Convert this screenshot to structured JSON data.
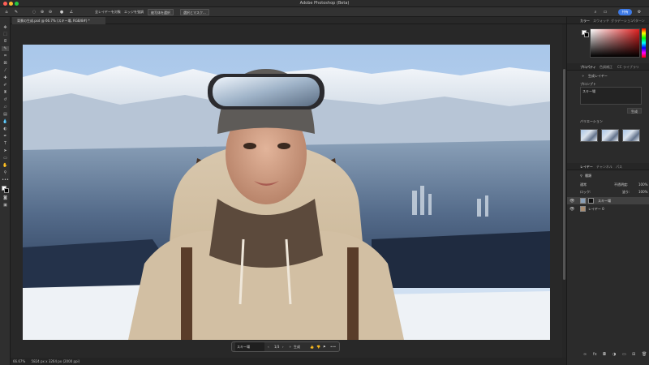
{
  "window": {
    "title": "Adobe Photoshop (Beta)"
  },
  "options_bar": {
    "sample_all_layers": "全レイヤーを対象",
    "auto_enhance": "エッジを強調",
    "select_subject": "被写体を選択",
    "select_and_mask": "選択とマスク...",
    "share_label": "共有"
  },
  "document_tab": {
    "label": "背景の生成.psd @ 66.7% (スキー場, RGB/8#) *"
  },
  "status_bar": {
    "zoom": "66.67%",
    "doc_size": "5824 px x 3264 px (2000 ppi)"
  },
  "task_bar": {
    "prompt": "スキー場",
    "page": "1/3",
    "generate_label": "生成",
    "more": "•••"
  },
  "color_panel": {
    "tabs": [
      "カラー",
      "スウォッチ",
      "グラデーション",
      "パターン"
    ],
    "foreground": "#ffffff",
    "background": "#000000",
    "hue_color": "#e02020"
  },
  "properties_panel": {
    "tabs": [
      "プロパティ",
      "色調補正",
      "CC ライブラリ"
    ],
    "layer_type": "生成レイヤー",
    "prompt_label": "プロンプト",
    "prompt_value": "スキー場",
    "generate_button": "生成",
    "variations_label": "バリエーション"
  },
  "layers_panel": {
    "tabs": [
      "レイヤー",
      "チャンネル",
      "パス"
    ],
    "filter_label": "種類",
    "blend_mode": "通常",
    "opacity_label": "不透明度:",
    "opacity_value": "100%",
    "lock_label": "ロック:",
    "fill_label": "塗り:",
    "fill_value": "100%",
    "layers": [
      {
        "name": "スキー場",
        "selected": true
      },
      {
        "name": "レイヤー 0",
        "selected": false
      }
    ]
  }
}
